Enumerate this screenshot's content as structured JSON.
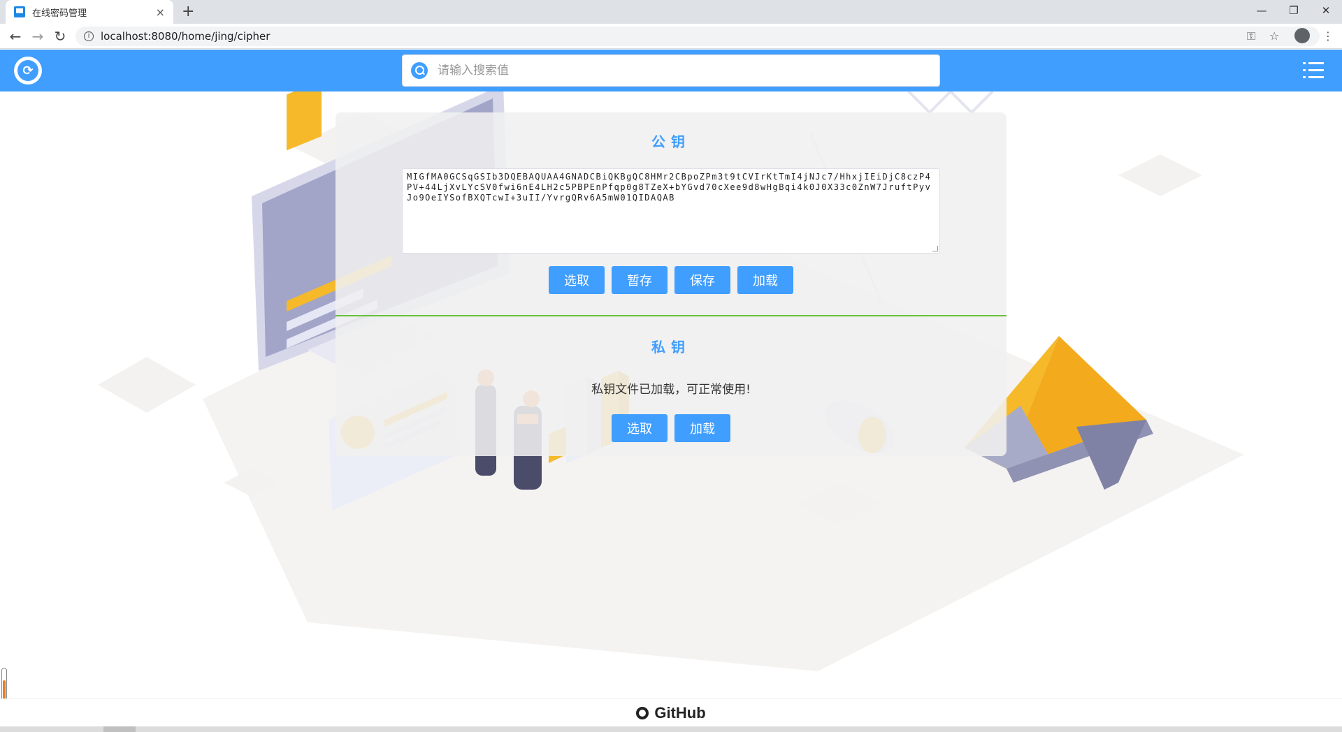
{
  "browser": {
    "tab_title": "在线密码管理",
    "tab_close": "×",
    "new_tab": "+",
    "url": "localhost:8080/home/jing/cipher",
    "back": "←",
    "forward": "→",
    "reload": "↻",
    "minimize": "—",
    "restore": "❐",
    "close": "✕"
  },
  "header": {
    "search_placeholder": "请输入搜索值"
  },
  "public_key": {
    "title": "公钥",
    "value": "MIGfMA0GCSqGSIb3DQEBAQUAA4GNADCBiQKBgQC8HMr2CBpoZPm3t9tCVIrKtTmI4jNJc7/HhxjIEiDjC8czP4PV+44LjXvLYcSV0fwi6nE4LH2c5PBPEnPfqp0g8TZeX+bYGvd70cXee9d8wHgBqi4k0J0X33c0ZnW7JruftPyvJo9OeIYSofBXQTcwI+3uII/YvrgQRv6A5mW01QIDAQAB",
    "buttons": [
      "选取",
      "暂存",
      "保存",
      "加载"
    ]
  },
  "private_key": {
    "title": "私钥",
    "status": "私钥文件已加载，可正常使用!",
    "buttons": [
      "选取",
      "加载"
    ]
  },
  "footer": {
    "github_label": "GitHub"
  },
  "colors": {
    "primary": "#409eff",
    "divider": "#67c23a"
  }
}
